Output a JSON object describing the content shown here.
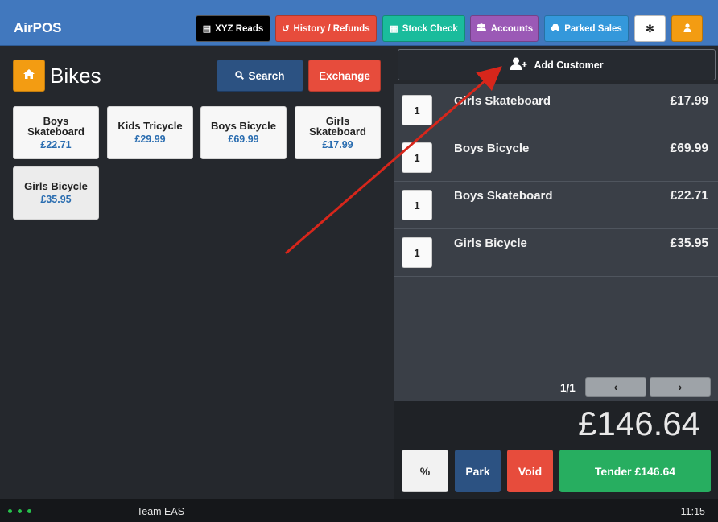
{
  "app": {
    "title": "AirPOS"
  },
  "toolbar": {
    "xyz_reads": "XYZ Reads",
    "history_refunds": "History / Refunds",
    "stock_check": "Stock Check",
    "accounts": "Accounts",
    "parked_sales": "Parked Sales",
    "settings_icon": "gear-icon",
    "user_icon": "user-icon",
    "colors": {
      "black": "#000000",
      "red": "#e74c3c",
      "teal": "#1abc9c",
      "purple": "#9b59b6",
      "blue": "#3498db",
      "white": "#ffffff",
      "orange": "#f39c12"
    }
  },
  "category": {
    "title": "Bikes",
    "search_label": "Search",
    "exchange_label": "Exchange"
  },
  "products": [
    {
      "name": "Boys Skateboard",
      "price": "£22.71"
    },
    {
      "name": "Kids Tricycle",
      "price": "£29.99"
    },
    {
      "name": "Boys Bicycle",
      "price": "£69.99"
    },
    {
      "name": "Girls Skateboard",
      "price": "£17.99"
    },
    {
      "name": "Girls Bicycle",
      "price": "£35.95"
    }
  ],
  "cart": {
    "add_customer_label": "Add Customer",
    "items": [
      {
        "qty": "1",
        "name": "Girls Skateboard",
        "price": "£17.99"
      },
      {
        "qty": "1",
        "name": "Boys Bicycle",
        "price": "£69.99"
      },
      {
        "qty": "1",
        "name": "Boys Skateboard",
        "price": "£22.71"
      },
      {
        "qty": "1",
        "name": "Girls Bicycle",
        "price": "£35.95"
      }
    ],
    "page": "1/1",
    "total": "£146.64"
  },
  "actions": {
    "discount": "%",
    "park": "Park",
    "void": "Void",
    "tender": "Tender £146.64"
  },
  "footer": {
    "team": "Team EAS",
    "time": "11:15"
  }
}
